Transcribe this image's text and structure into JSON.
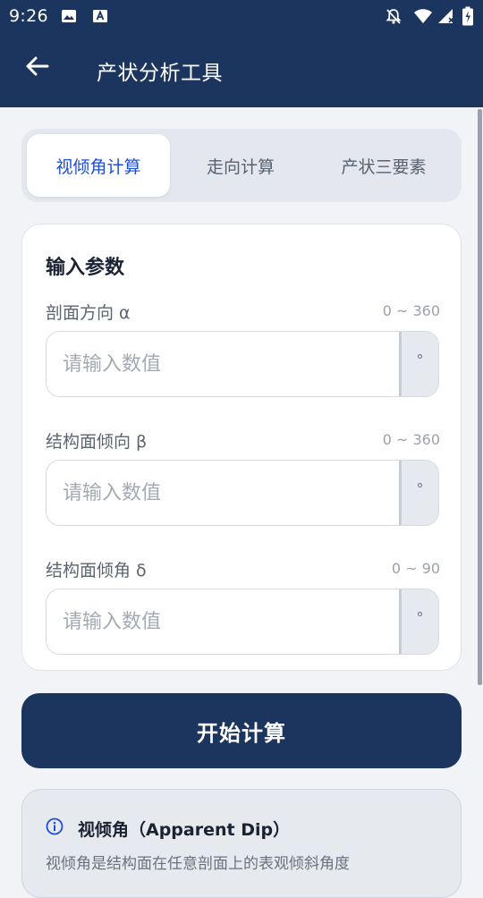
{
  "status_bar": {
    "time": "9:26"
  },
  "app_bar": {
    "title": "产状分析工具"
  },
  "tabs": [
    {
      "label": "视倾角计算",
      "active": true
    },
    {
      "label": "走向计算",
      "active": false
    },
    {
      "label": "产状三要素",
      "active": false
    }
  ],
  "card": {
    "title": "输入参数",
    "fields": [
      {
        "label": "剖面方向 α",
        "range": "0 ~ 360",
        "placeholder": "请输入数值",
        "unit": "°"
      },
      {
        "label": "结构面倾向 β",
        "range": "0 ~ 360",
        "placeholder": "请输入数值",
        "unit": "°"
      },
      {
        "label": "结构面倾角 δ",
        "range": "0 ~ 90",
        "placeholder": "请输入数值",
        "unit": "°"
      }
    ]
  },
  "button": {
    "label": "开始计算"
  },
  "info": {
    "title": "视倾角（Apparent Dip）",
    "desc": "视倾角是结构面在任意剖面上的表观倾斜角度"
  },
  "colors": {
    "primary": "#1c355e",
    "accent": "#1d4ed8",
    "background": "#f1f3f6"
  },
  "icons": [
    "gallery-icon",
    "font-icon",
    "notifications-off-icon",
    "wifi-icon",
    "signal-icon",
    "battery-icon",
    "back-arrow-icon",
    "info-icon"
  ]
}
